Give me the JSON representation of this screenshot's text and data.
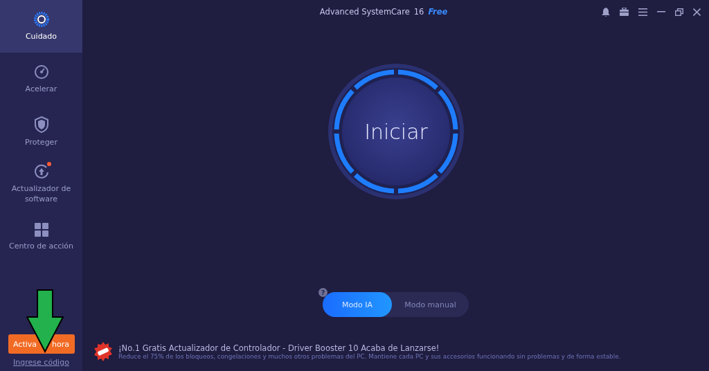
{
  "window": {
    "title": "Advanced SystemCare",
    "version": "16",
    "edition": "Free"
  },
  "sidebar": {
    "items": [
      {
        "kind": "care",
        "label": "Cuidado",
        "selected": true,
        "badge": false
      },
      {
        "kind": "speed",
        "label": "Acelerar",
        "selected": false,
        "badge": false
      },
      {
        "kind": "shield",
        "label": "Proteger",
        "selected": false,
        "badge": false
      },
      {
        "kind": "update",
        "label": "Actualizador de software",
        "selected": false,
        "badge": true
      },
      {
        "kind": "grid",
        "label": "Centro de acción",
        "selected": false,
        "badge": false
      }
    ],
    "activate_button": [
      "Activa",
      "hora"
    ],
    "code_link": "Ingrese código"
  },
  "dial": {
    "label": "Iniciar"
  },
  "mode_toggle": {
    "help": "?",
    "modes": [
      {
        "label": "Modo IA",
        "selected": true
      },
      {
        "label": "Modo manual",
        "selected": false
      }
    ]
  },
  "news": {
    "headline": "¡No.1 Gratis Actualizador de Controlador - Driver Booster 10 Acaba de Lanzarse!",
    "description": "Reduce el 75% de los bloqueos, congelaciones y muchos otros problemas del PC. Mantiene cada PC y sus accesorios funcionando sin problemas y de forma estable."
  }
}
